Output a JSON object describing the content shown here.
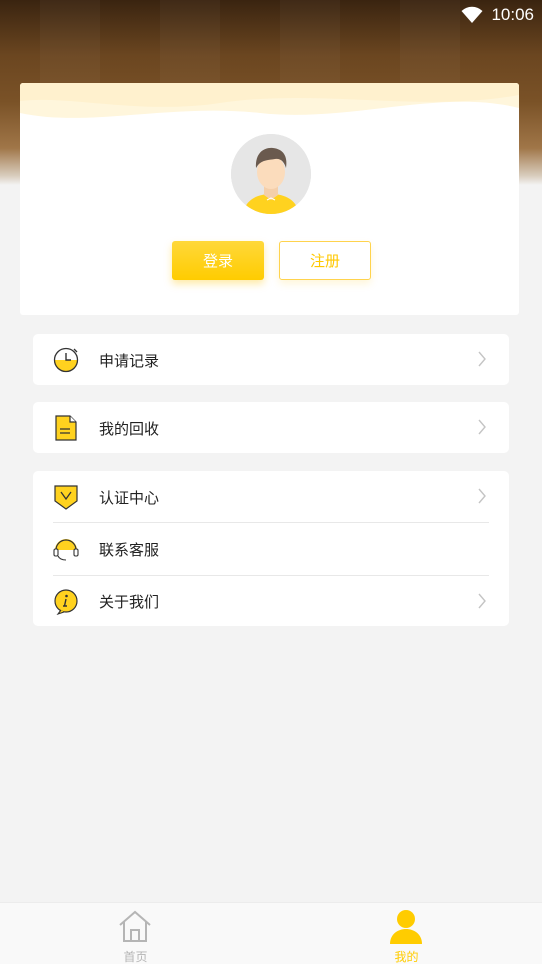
{
  "statusbar": {
    "time": "10:06",
    "wifi_icon": "wifi-icon"
  },
  "profile": {
    "avatar_icon": "user-avatar-icon",
    "login_label": "登录",
    "register_label": "注册"
  },
  "menu_group1": [
    {
      "label": "申请记录",
      "icon": "clock-icon",
      "has_arrow": true
    }
  ],
  "menu_group2": [
    {
      "label": "我的回收",
      "icon": "document-icon",
      "has_arrow": true
    }
  ],
  "menu_group3": [
    {
      "label": "认证中心",
      "icon": "verify-shield-icon",
      "has_arrow": true
    },
    {
      "label": "联系客服",
      "icon": "headset-icon",
      "has_arrow": false
    },
    {
      "label": "关于我们",
      "icon": "info-icon",
      "has_arrow": true
    }
  ],
  "tabbar": {
    "home_label": "首页",
    "mine_label": "我的",
    "active": "mine",
    "active_color": "#ffcc00",
    "inactive_color": "#b5b5b5"
  }
}
